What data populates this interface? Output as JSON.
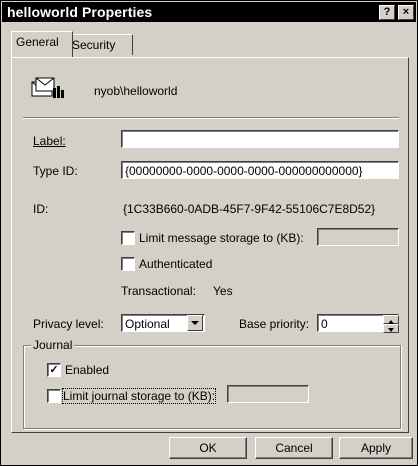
{
  "window": {
    "title": "helloworld Properties",
    "help_glyph": "?",
    "close_glyph": "×"
  },
  "tabs": [
    {
      "label": "General",
      "active": true
    },
    {
      "label": "Security",
      "active": false
    }
  ],
  "general": {
    "queue_name": "nyob\\helloworld",
    "queue_icon": "mail-queue-icon",
    "label_text": "Label:",
    "label_value": "",
    "type_id_text": "Type ID:",
    "type_id_value": "{00000000-0000-0000-0000-000000000000}",
    "id_text": "ID:",
    "id_value": "{1C33B660-0ADB-45F7-9F42-55106C7E8D52}",
    "limit_msg_text": "Limit message storage to (KB):",
    "limit_msg_checked": false,
    "limit_msg_value": "",
    "authenticated_text": "Authenticated",
    "authenticated_checked": false,
    "transactional_text": "Transactional:",
    "transactional_value": "Yes",
    "privacy_text": "Privacy level:",
    "privacy_value": "Optional",
    "base_priority_text": "Base priority:",
    "base_priority_value": "0"
  },
  "journal": {
    "group_title": "Journal",
    "enabled_text": "Enabled",
    "enabled_checked": true,
    "limit_text": "Limit journal storage to (KB):",
    "limit_checked": false,
    "limit_value": ""
  },
  "buttons": {
    "ok": "OK",
    "cancel": "Cancel",
    "apply": "Apply"
  },
  "glyphs": {
    "check": "✓",
    "dropdown": "▼",
    "up": "▲",
    "down": "▼"
  }
}
